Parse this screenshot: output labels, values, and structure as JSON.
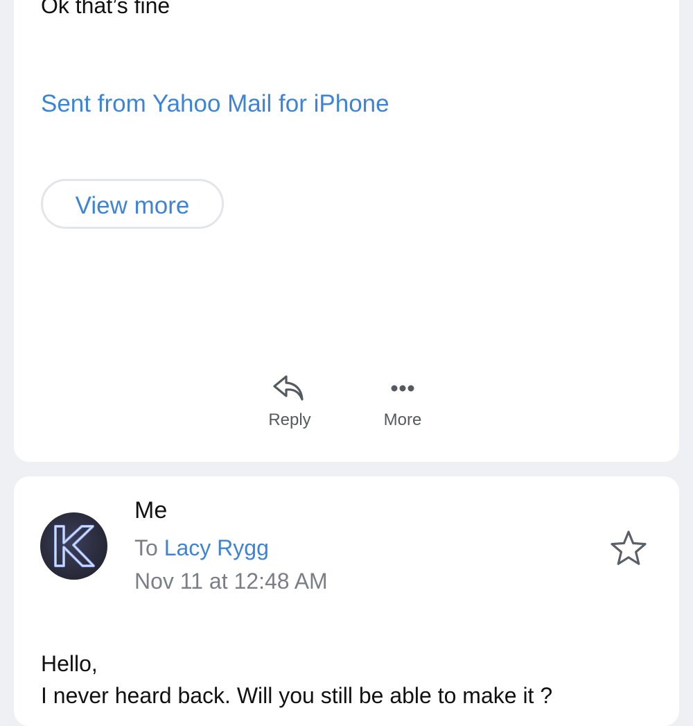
{
  "message_1": {
    "body_text": "Ok that’s fine",
    "signature": "Sent from Yahoo Mail for iPhone",
    "view_more_label": "View more",
    "actions": {
      "reply_label": "Reply",
      "more_label": "More"
    }
  },
  "message_2": {
    "sender": "Me",
    "recipient_prefix": "To",
    "recipient": "Lacy Rygg",
    "timestamp": "Nov 11 at 12:48 AM",
    "avatar_letter": "K",
    "body_line_1": "Hello,",
    "body_line_2": "I never heard back. Will you still be able to make it ?"
  },
  "colors": {
    "background": "#eff0f3",
    "card": "#ffffff",
    "link_blue": "#3d84d6",
    "secondary_text": "#7a7f87",
    "icon_gray": "#555a61"
  }
}
